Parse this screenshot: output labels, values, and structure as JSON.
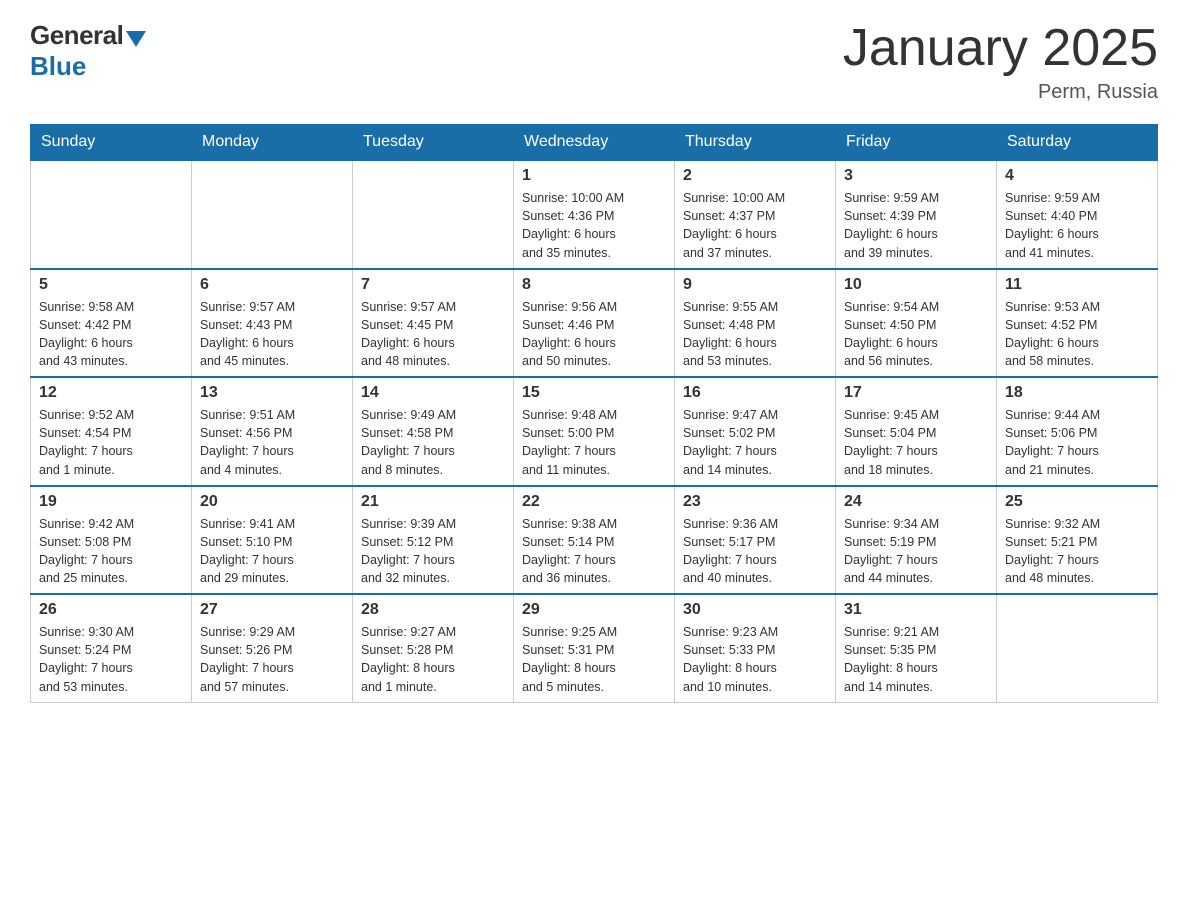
{
  "logo": {
    "general": "General",
    "blue": "Blue"
  },
  "title": "January 2025",
  "location": "Perm, Russia",
  "days_of_week": [
    "Sunday",
    "Monday",
    "Tuesday",
    "Wednesday",
    "Thursday",
    "Friday",
    "Saturday"
  ],
  "weeks": [
    [
      {
        "day": "",
        "info": ""
      },
      {
        "day": "",
        "info": ""
      },
      {
        "day": "",
        "info": ""
      },
      {
        "day": "1",
        "info": "Sunrise: 10:00 AM\nSunset: 4:36 PM\nDaylight: 6 hours\nand 35 minutes."
      },
      {
        "day": "2",
        "info": "Sunrise: 10:00 AM\nSunset: 4:37 PM\nDaylight: 6 hours\nand 37 minutes."
      },
      {
        "day": "3",
        "info": "Sunrise: 9:59 AM\nSunset: 4:39 PM\nDaylight: 6 hours\nand 39 minutes."
      },
      {
        "day": "4",
        "info": "Sunrise: 9:59 AM\nSunset: 4:40 PM\nDaylight: 6 hours\nand 41 minutes."
      }
    ],
    [
      {
        "day": "5",
        "info": "Sunrise: 9:58 AM\nSunset: 4:42 PM\nDaylight: 6 hours\nand 43 minutes."
      },
      {
        "day": "6",
        "info": "Sunrise: 9:57 AM\nSunset: 4:43 PM\nDaylight: 6 hours\nand 45 minutes."
      },
      {
        "day": "7",
        "info": "Sunrise: 9:57 AM\nSunset: 4:45 PM\nDaylight: 6 hours\nand 48 minutes."
      },
      {
        "day": "8",
        "info": "Sunrise: 9:56 AM\nSunset: 4:46 PM\nDaylight: 6 hours\nand 50 minutes."
      },
      {
        "day": "9",
        "info": "Sunrise: 9:55 AM\nSunset: 4:48 PM\nDaylight: 6 hours\nand 53 minutes."
      },
      {
        "day": "10",
        "info": "Sunrise: 9:54 AM\nSunset: 4:50 PM\nDaylight: 6 hours\nand 56 minutes."
      },
      {
        "day": "11",
        "info": "Sunrise: 9:53 AM\nSunset: 4:52 PM\nDaylight: 6 hours\nand 58 minutes."
      }
    ],
    [
      {
        "day": "12",
        "info": "Sunrise: 9:52 AM\nSunset: 4:54 PM\nDaylight: 7 hours\nand 1 minute."
      },
      {
        "day": "13",
        "info": "Sunrise: 9:51 AM\nSunset: 4:56 PM\nDaylight: 7 hours\nand 4 minutes."
      },
      {
        "day": "14",
        "info": "Sunrise: 9:49 AM\nSunset: 4:58 PM\nDaylight: 7 hours\nand 8 minutes."
      },
      {
        "day": "15",
        "info": "Sunrise: 9:48 AM\nSunset: 5:00 PM\nDaylight: 7 hours\nand 11 minutes."
      },
      {
        "day": "16",
        "info": "Sunrise: 9:47 AM\nSunset: 5:02 PM\nDaylight: 7 hours\nand 14 minutes."
      },
      {
        "day": "17",
        "info": "Sunrise: 9:45 AM\nSunset: 5:04 PM\nDaylight: 7 hours\nand 18 minutes."
      },
      {
        "day": "18",
        "info": "Sunrise: 9:44 AM\nSunset: 5:06 PM\nDaylight: 7 hours\nand 21 minutes."
      }
    ],
    [
      {
        "day": "19",
        "info": "Sunrise: 9:42 AM\nSunset: 5:08 PM\nDaylight: 7 hours\nand 25 minutes."
      },
      {
        "day": "20",
        "info": "Sunrise: 9:41 AM\nSunset: 5:10 PM\nDaylight: 7 hours\nand 29 minutes."
      },
      {
        "day": "21",
        "info": "Sunrise: 9:39 AM\nSunset: 5:12 PM\nDaylight: 7 hours\nand 32 minutes."
      },
      {
        "day": "22",
        "info": "Sunrise: 9:38 AM\nSunset: 5:14 PM\nDaylight: 7 hours\nand 36 minutes."
      },
      {
        "day": "23",
        "info": "Sunrise: 9:36 AM\nSunset: 5:17 PM\nDaylight: 7 hours\nand 40 minutes."
      },
      {
        "day": "24",
        "info": "Sunrise: 9:34 AM\nSunset: 5:19 PM\nDaylight: 7 hours\nand 44 minutes."
      },
      {
        "day": "25",
        "info": "Sunrise: 9:32 AM\nSunset: 5:21 PM\nDaylight: 7 hours\nand 48 minutes."
      }
    ],
    [
      {
        "day": "26",
        "info": "Sunrise: 9:30 AM\nSunset: 5:24 PM\nDaylight: 7 hours\nand 53 minutes."
      },
      {
        "day": "27",
        "info": "Sunrise: 9:29 AM\nSunset: 5:26 PM\nDaylight: 7 hours\nand 57 minutes."
      },
      {
        "day": "28",
        "info": "Sunrise: 9:27 AM\nSunset: 5:28 PM\nDaylight: 8 hours\nand 1 minute."
      },
      {
        "day": "29",
        "info": "Sunrise: 9:25 AM\nSunset: 5:31 PM\nDaylight: 8 hours\nand 5 minutes."
      },
      {
        "day": "30",
        "info": "Sunrise: 9:23 AM\nSunset: 5:33 PM\nDaylight: 8 hours\nand 10 minutes."
      },
      {
        "day": "31",
        "info": "Sunrise: 9:21 AM\nSunset: 5:35 PM\nDaylight: 8 hours\nand 14 minutes."
      },
      {
        "day": "",
        "info": ""
      }
    ]
  ]
}
